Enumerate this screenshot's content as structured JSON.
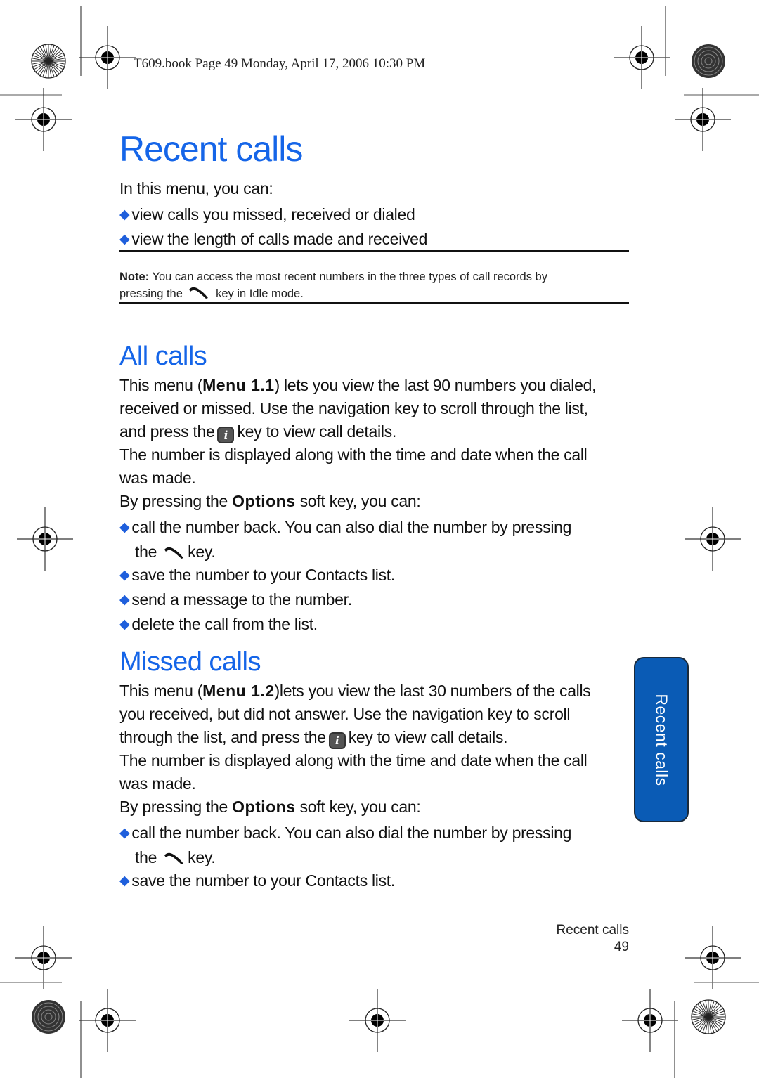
{
  "header": {
    "print_line": "T609.book  Page 49  Monday, April 17, 2006  10:30 PM"
  },
  "page_title": "Recent calls",
  "intro": {
    "lead": "In this menu, you can:",
    "bullets": [
      "view calls you missed, received or dialed",
      "view the length of calls made and received"
    ]
  },
  "note": {
    "label": "Note:",
    "line1": " You can access the most recent numbers in the three types of call records by",
    "line2_before": "pressing the",
    "line2_after": "key in Idle mode."
  },
  "sections": {
    "all_calls": {
      "title": "All calls",
      "line1_pre": "This menu (",
      "menu_ref": "Menu 1.1",
      "line1_post": ") lets you view the last 90 numbers you dialed,",
      "line2": "received or missed. Use the navigation key to scroll through the list,",
      "line3_pre": "and press the",
      "line3_post": "key to view call details.",
      "line4": "The number is displayed along with the time and date when the call",
      "line5": "was made.",
      "options_pre": "By pressing the ",
      "options_key": "Options",
      "options_post": " soft key, you can:",
      "bullets": [
        "call the number back. You can also dial the number by pressing",
        "save the number to your Contacts list.",
        "send a message to the number.",
        "delete the call from the list."
      ],
      "bullet1_cont_pre": "the",
      "bullet1_cont_post": "key."
    },
    "missed_calls": {
      "title": "Missed calls",
      "line1_pre": "This menu (",
      "menu_ref": "Menu 1.2",
      "line1_post": ")lets you view the last 30 numbers of the calls",
      "line2": "you received, but did not answer. Use the navigation key to scroll",
      "line3_pre": "through the list, and press the",
      "line3_post": "key to view call details.",
      "line4": "The number is displayed along with the time and date when the call",
      "line5": "was made.",
      "options_pre": "By pressing the ",
      "options_key": "Options",
      "options_post": " soft key, you can:",
      "bullets": [
        "call the number back. You can also dial the number by pressing",
        "save the number to your Contacts list."
      ],
      "bullet1_cont_pre": "the",
      "bullet1_cont_post": "key."
    }
  },
  "side_tab": {
    "label": "Recent calls",
    "color": "#0a5bb5"
  },
  "footer": {
    "section": "Recent calls",
    "page_number": "49"
  },
  "colors": {
    "heading": "#1565e8",
    "bullet": "#1f5fdc"
  },
  "icons": {
    "bullet": "◆",
    "info_key": "i",
    "send_key": "phone-send-key-icon"
  }
}
